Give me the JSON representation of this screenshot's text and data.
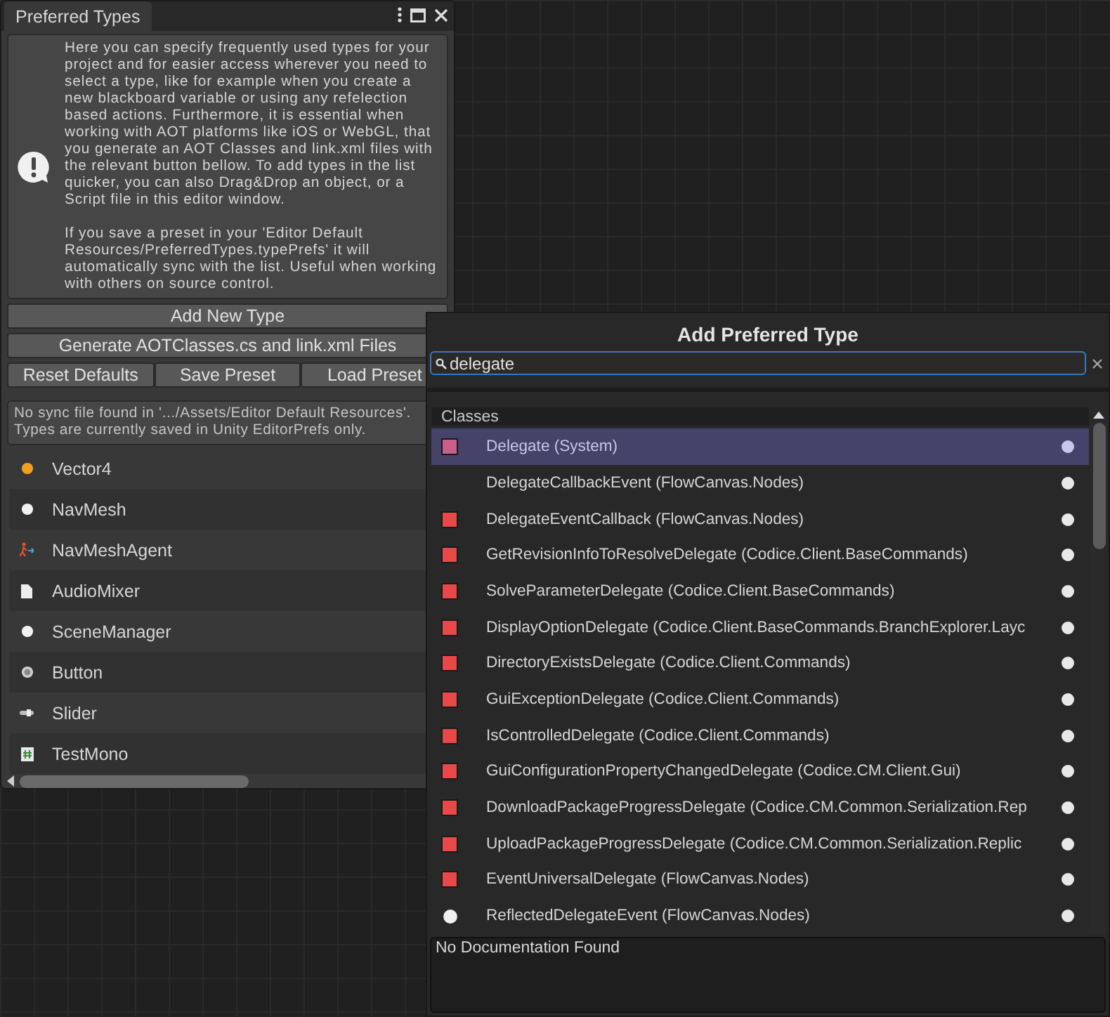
{
  "window": {
    "title": "Preferred Types"
  },
  "help_box": {
    "paragraphs": [
      "Here you can specify frequently used types for your project and for easier access wherever you need to select a type, like for example when you create a new blackboard variable or using any refelection based actions. Furthermore, it is essential when working with AOT platforms like iOS or WebGL, that you generate an AOT Classes and link.xml files with the relevant button bellow. To add types in the list quicker, you can also Drag&Drop an object, or a Script file in this editor window.",
      "If you save a preset in your 'Editor Default Resources/PreferredTypes.typePrefs' it will automatically sync with the list. Useful when working with others on source control."
    ]
  },
  "buttons": [
    [
      "Add New Type"
    ],
    [
      "Generate AOTClasses.cs and link.xml Files"
    ],
    [
      "Reset Defaults",
      "Save Preset",
      "Load Preset"
    ]
  ],
  "sync_note": "No sync file found in '.../Assets/Editor Default Resources'. Types are currently saved in Unity EditorPrefs only.",
  "types": [
    {
      "name": "Vector4",
      "kind": "orange-dot"
    },
    {
      "name": "NavMesh",
      "kind": "white-dot"
    },
    {
      "name": "NavMeshAgent",
      "kind": "agent"
    },
    {
      "name": "AudioMixer",
      "kind": "document"
    },
    {
      "name": "SceneManager",
      "kind": "white-dot"
    },
    {
      "name": "Button",
      "kind": "button"
    },
    {
      "name": "Slider",
      "kind": "slider"
    },
    {
      "name": "TestMono",
      "kind": "script"
    }
  ],
  "popup": {
    "title": "Add Preferred Type",
    "search": {
      "value": "delegate"
    },
    "section": "Classes",
    "rows": [
      {
        "label": "Delegate (System)",
        "kind": "square",
        "color": "#c8608a",
        "selected": true
      },
      {
        "label": "DelegateCallbackEvent (FlowCanvas.Nodes)",
        "kind": "none",
        "selected": false
      },
      {
        "label": "DelegateEventCallback (FlowCanvas.Nodes)",
        "kind": "square",
        "color": "#e84848",
        "selected": false
      },
      {
        "label": "GetRevisionInfoToResolveDelegate (Codice.Client.BaseCommands)",
        "kind": "square",
        "color": "#e84848",
        "selected": false
      },
      {
        "label": "SolveParameterDelegate (Codice.Client.BaseCommands)",
        "kind": "square",
        "color": "#e84848",
        "selected": false
      },
      {
        "label": "DisplayOptionDelegate (Codice.Client.BaseCommands.BranchExplorer.Layc",
        "kind": "square",
        "color": "#e84848",
        "selected": false
      },
      {
        "label": "DirectoryExistsDelegate (Codice.Client.Commands)",
        "kind": "square",
        "color": "#e84848",
        "selected": false
      },
      {
        "label": "GuiExceptionDelegate (Codice.Client.Commands)",
        "kind": "square",
        "color": "#e84848",
        "selected": false
      },
      {
        "label": "IsControlledDelegate (Codice.Client.Commands)",
        "kind": "square",
        "color": "#e84848",
        "selected": false
      },
      {
        "label": "GuiConfigurationPropertyChangedDelegate (Codice.CM.Client.Gui)",
        "kind": "square",
        "color": "#e84848",
        "selected": false
      },
      {
        "label": "DownloadPackageProgressDelegate (Codice.CM.Common.Serialization.Rep",
        "kind": "square",
        "color": "#e84848",
        "selected": false
      },
      {
        "label": "UploadPackageProgressDelegate (Codice.CM.Common.Serialization.Replic",
        "kind": "square",
        "color": "#e84848",
        "selected": false
      },
      {
        "label": "EventUniversalDelegate (FlowCanvas.Nodes)",
        "kind": "square",
        "color": "#e84848",
        "selected": false
      },
      {
        "label": "ReflectedDelegateEvent (FlowCanvas.Nodes)",
        "kind": "circle",
        "selected": false
      }
    ],
    "documentation": "No Documentation Found"
  }
}
